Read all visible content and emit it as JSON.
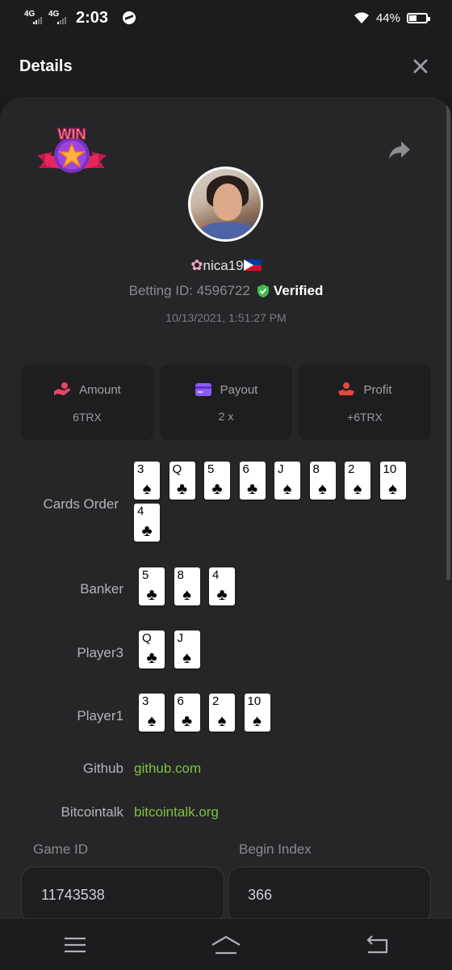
{
  "status_bar": {
    "signal1": "4G",
    "signal2": "4G",
    "time": "2:03",
    "battery": "44%"
  },
  "header": {
    "title": "Details"
  },
  "profile": {
    "username": "nica19",
    "betting_id_label": "Betting ID: 4596722",
    "verified_label": "Verified",
    "datetime": "10/13/2021, 1:51:27 PM",
    "badge_text": "WIN"
  },
  "stats": [
    {
      "label": "Amount",
      "value": "6TRX",
      "icon": "hand-coin-icon",
      "color": "#e8456b"
    },
    {
      "label": "Payout",
      "value": "2 x",
      "icon": "card-payment-icon",
      "color": "#8a5cf6"
    },
    {
      "label": "Profit",
      "value": "+6TRX",
      "icon": "hand-profit-icon",
      "color": "#e8473f"
    }
  ],
  "rows": {
    "cards_order": {
      "label": "Cards Order",
      "cards": [
        {
          "rank": "3",
          "suit": "♠"
        },
        {
          "rank": "Q",
          "suit": "♣"
        },
        {
          "rank": "5",
          "suit": "♣"
        },
        {
          "rank": "6",
          "suit": "♣"
        },
        {
          "rank": "J",
          "suit": "♠"
        },
        {
          "rank": "8",
          "suit": "♠"
        },
        {
          "rank": "2",
          "suit": "♠"
        },
        {
          "rank": "10",
          "suit": "♠"
        },
        {
          "rank": "4",
          "suit": "♣"
        }
      ]
    },
    "banker": {
      "label": "Banker",
      "cards": [
        {
          "rank": "5",
          "suit": "♣"
        },
        {
          "rank": "8",
          "suit": "♠"
        },
        {
          "rank": "4",
          "suit": "♣"
        }
      ]
    },
    "player3": {
      "label": "Player3",
      "cards": [
        {
          "rank": "Q",
          "suit": "♣"
        },
        {
          "rank": "J",
          "suit": "♠"
        }
      ]
    },
    "player1": {
      "label": "Player1",
      "cards": [
        {
          "rank": "3",
          "suit": "♠"
        },
        {
          "rank": "6",
          "suit": "♣"
        },
        {
          "rank": "2",
          "suit": "♠"
        },
        {
          "rank": "10",
          "suit": "♠"
        }
      ]
    }
  },
  "links": {
    "github_label": "Github",
    "github_value": "github.com",
    "bitcointalk_label": "Bitcointalk",
    "bitcointalk_value": "bitcointalk.org"
  },
  "fields": {
    "game_id_label": "Game ID",
    "game_id_value": "11743538",
    "begin_index_label": "Begin Index",
    "begin_index_value": "366"
  },
  "colors": {
    "link": "#7dc23a",
    "verified": "#3fbf4a",
    "background": "#19191b",
    "sheet": "#262628"
  }
}
